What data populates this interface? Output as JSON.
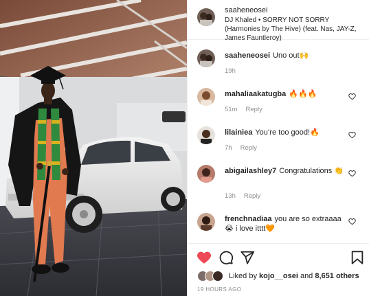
{
  "post": {
    "author": "saaheneosei",
    "audio": "DJ Khaled • SORRY NOT SORRY (Harmonies by The Hive) (feat. Nas, JAY-Z, James Fauntleroy)"
  },
  "caption": {
    "user": "saaheneosei",
    "text": "Uno out🙌",
    "time": "19h"
  },
  "comments": [
    {
      "user": "mahaliaakatugba",
      "text": "🔥🔥🔥",
      "time": "51m",
      "reply": "Reply"
    },
    {
      "user": "lilainiea",
      "text": "You’re too good!🔥",
      "time": "7h",
      "reply": "Reply"
    },
    {
      "user": "abigailashley7",
      "text": "Congratulations 👏",
      "time": "13h",
      "reply": "Reply"
    },
    {
      "user": "frenchnadiaa",
      "text": "you are so extraaaa 😭 i love itttt🧡",
      "time": "",
      "reply": ""
    }
  ],
  "likes": {
    "prefix": "Liked by ",
    "user": "kojo__osei",
    "middle": " and ",
    "count": "8,651 others"
  },
  "posted_time": "19 HOURS AGO",
  "colors": {
    "like_red": "#ed4956",
    "text": "#262626",
    "muted": "#8e8e8e",
    "divider": "#efefef"
  },
  "icons": [
    "heart-icon",
    "comment-icon",
    "share-icon",
    "bookmark-icon",
    "small-heart-icon"
  ]
}
